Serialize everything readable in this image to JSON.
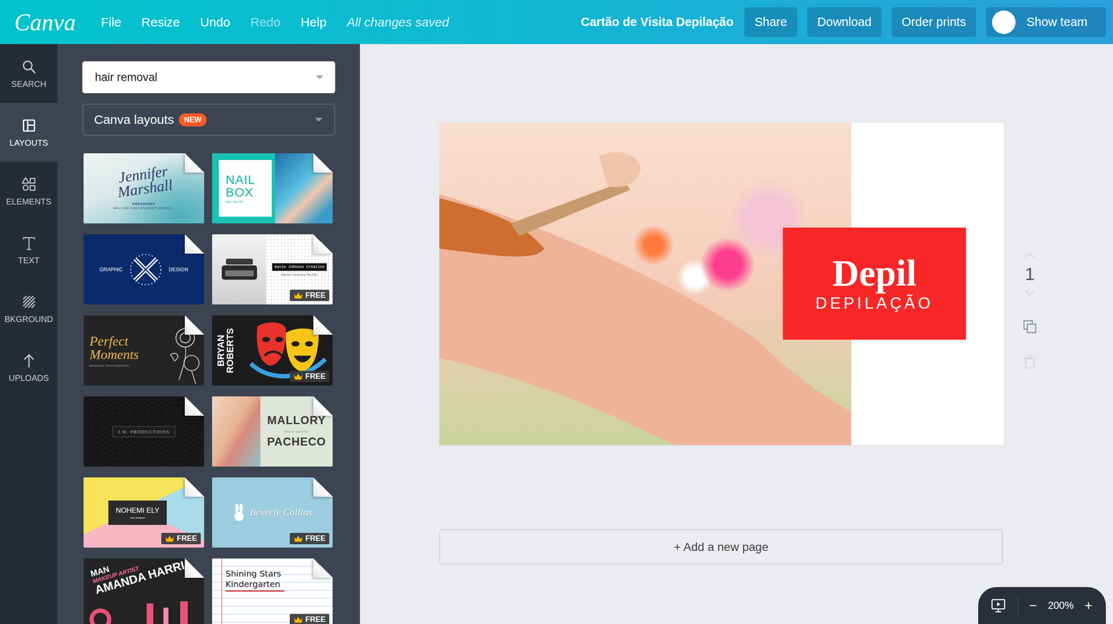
{
  "topbar": {
    "logo": "Canva",
    "menu": [
      {
        "label": "File",
        "disabled": false
      },
      {
        "label": "Resize",
        "disabled": false
      },
      {
        "label": "Undo",
        "disabled": false
      },
      {
        "label": "Redo",
        "disabled": true
      },
      {
        "label": "Help",
        "disabled": false
      }
    ],
    "status": "All changes saved",
    "title": "Cartão de Visita Depilação",
    "buttons": [
      "Share",
      "Download",
      "Order prints"
    ],
    "team_button": "Show team"
  },
  "rail": [
    {
      "label": "SEARCH",
      "selected": false
    },
    {
      "label": "LAYOUTS",
      "selected": true
    },
    {
      "label": "ELEMENTS",
      "selected": false
    },
    {
      "label": "TEXT",
      "selected": false
    },
    {
      "label": "BKGROUND",
      "selected": false
    },
    {
      "label": "UPLOADS",
      "selected": false
    }
  ],
  "panel": {
    "search_value": "hair removal",
    "dropdown": {
      "label": "Canva layouts",
      "badge": "NEW"
    },
    "free_label": "FREE",
    "layouts": [
      {
        "kind": "watercolor",
        "texts": [
          "Jennifer Marshall",
          "PRESIDENT",
          "MALCOM HIGH STUDENT COUNCIL"
        ],
        "free": false
      },
      {
        "kind": "nail",
        "texts": [
          "NAIL",
          "BOX",
          "NAIL SALON"
        ],
        "free": false
      },
      {
        "kind": "graphic",
        "texts": [
          "GRAPHIC",
          "DESIGN"
        ],
        "free": false
      },
      {
        "kind": "typewriter",
        "texts": [
          "Katie Johnson Creative",
          "Effective Copywriting That Sells"
        ],
        "free": true
      },
      {
        "kind": "floral",
        "texts": [
          "Perfect Moments",
          "WEDDING PHOTOGRAPHY"
        ],
        "free": false
      },
      {
        "kind": "masks",
        "texts": [
          "BRYAN",
          "ROBERTS"
        ],
        "free": true
      },
      {
        "kind": "scallop",
        "texts": [
          "J.W. PRODUCTIONS"
        ],
        "free": false
      },
      {
        "kind": "portrait",
        "texts": [
          "MALLORY",
          "mural painter",
          "PACHECO"
        ],
        "free": false
      },
      {
        "kind": "geometric",
        "texts": [
          "NOHEMI ELY",
          "web designer"
        ],
        "free": true
      },
      {
        "kind": "bunny",
        "texts": [
          "Beverly Collins"
        ],
        "free": true
      },
      {
        "kind": "makeup",
        "texts": [
          "MAN",
          "MAKEUP ARTIST",
          "AMANDA HARRI"
        ],
        "free": false
      },
      {
        "kind": "notebook",
        "texts": [
          "Shining Stars",
          "Kindergarten"
        ],
        "free": true
      }
    ]
  },
  "canvas": {
    "brand": "Depil",
    "subtitle": "DEPILAÇÃO",
    "page_number": "1",
    "add_page": "+ Add a new page"
  },
  "zoom": {
    "minus": "−",
    "value": "200%",
    "plus": "+"
  }
}
